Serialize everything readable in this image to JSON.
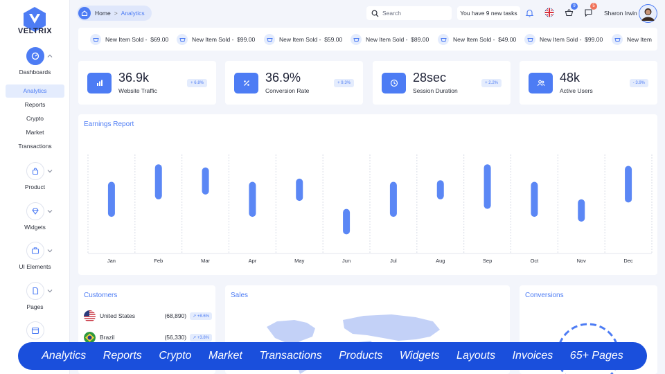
{
  "brand": {
    "name": "VELTRIX"
  },
  "sidebar": {
    "dashboards_label": "Dashboards",
    "sub_items": [
      "Analytics",
      "Reports",
      "Crypto",
      "Market",
      "Transactions"
    ],
    "groups": [
      "Product",
      "Widgets",
      "UI Elements",
      "Pages"
    ]
  },
  "topbar": {
    "breadcrumb_home": "Home",
    "breadcrumb_sep": ">",
    "breadcrumb_current": "Analytics",
    "search_placeholder": "Search",
    "tasks_text": "You have 9 new tasks",
    "cart_badge": "9",
    "messages_badge": "5",
    "user_name": "Sharon Irwin"
  },
  "ticker": [
    {
      "label": "New Item Sold -",
      "amount": "$69.00"
    },
    {
      "label": "New Item Sold -",
      "amount": "$99.00"
    },
    {
      "label": "New Item Sold -",
      "amount": "$59.00"
    },
    {
      "label": "New Item Sold -",
      "amount": "$89.00"
    },
    {
      "label": "New Item Sold -",
      "amount": "$49.00"
    },
    {
      "label": "New Item Sold -",
      "amount": "$99.00"
    },
    {
      "label": "New Item",
      "amount": ""
    }
  ],
  "stats": [
    {
      "value": "36.9k",
      "label": "Website Traffic",
      "change": "+ 6.8%"
    },
    {
      "value": "36.9%",
      "label": "Conversion Rate",
      "change": "+ 9.3%"
    },
    {
      "value": "28sec",
      "label": "Session Duration",
      "change": "+ 2.2%"
    },
    {
      "value": "48k",
      "label": "Active Users",
      "change": "- 3.9%"
    }
  ],
  "earnings": {
    "title": "Earnings Report"
  },
  "chart_data": {
    "type": "bar",
    "categories": [
      "Jan",
      "Feb",
      "Mar",
      "Apr",
      "May",
      "Jun",
      "Jul",
      "Aug",
      "Sep",
      "Oct",
      "Nov",
      "Dec"
    ],
    "series": [
      {
        "low": [
          23,
          34,
          37,
          23,
          33,
          12,
          23,
          34,
          28,
          23,
          20,
          32
        ],
        "high": [
          45,
          56,
          54,
          45,
          47,
          28,
          45,
          46,
          56,
          45,
          34,
          55
        ]
      }
    ],
    "ylim": [
      0,
      70
    ],
    "grid": "vertical-dashed",
    "color": "#5b87f5"
  },
  "customers": {
    "title": "Customers",
    "rows": [
      {
        "country": "United States",
        "value": "(68,890)",
        "change": "↗ +8.6%"
      },
      {
        "country": "Brazil",
        "value": "(56,330)",
        "change": "↗ +3.8%"
      }
    ]
  },
  "sales": {
    "title": "Sales"
  },
  "conversions": {
    "title": "Conversions"
  },
  "bottom_nav": [
    "Analytics",
    "Reports",
    "Crypto",
    "Market",
    "Transactions",
    "Products",
    "Widgets",
    "Layouts",
    "Invoices",
    "65+ Pages"
  ],
  "colors": {
    "accent": "#4d7cf4",
    "bar": "#5b87f5",
    "banner": "#1a4fdc",
    "badge_cart": "#4d7cf4",
    "badge_messages": "#f0735a"
  }
}
